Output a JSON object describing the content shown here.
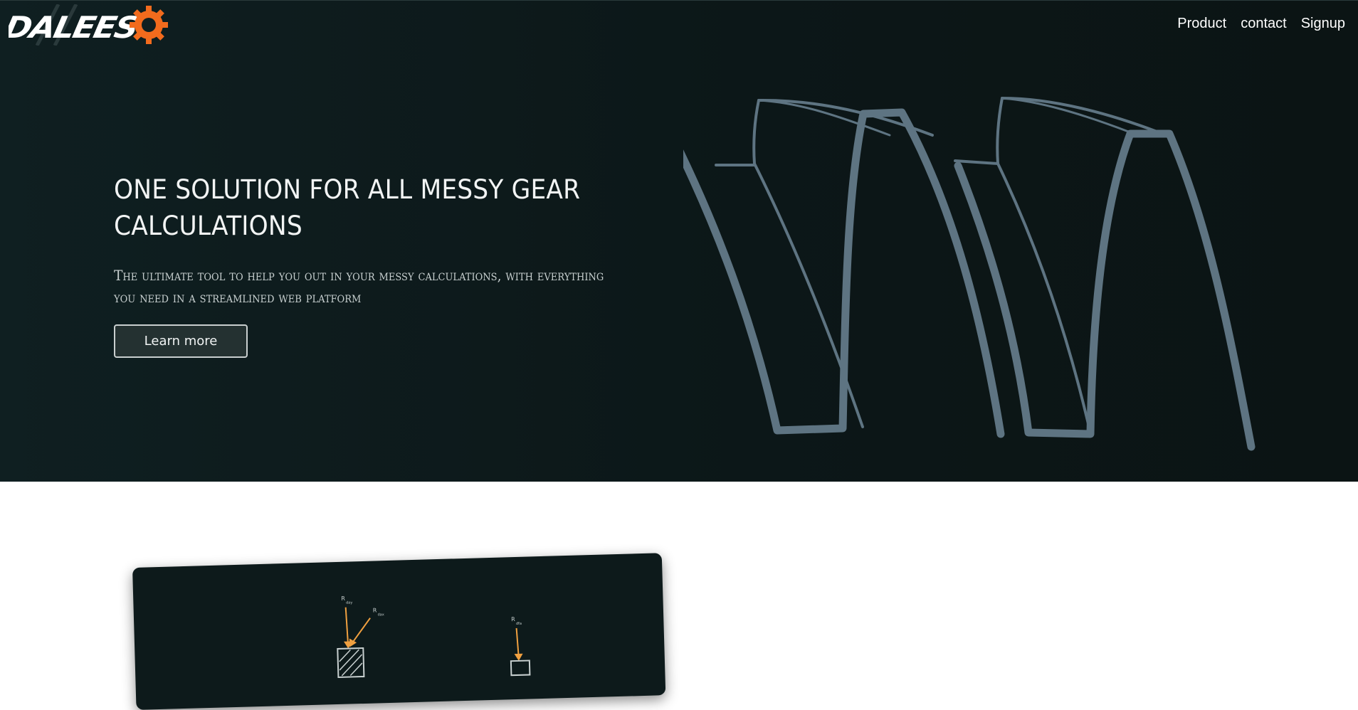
{
  "brand": {
    "logo_text": "DALEES",
    "accent": "#f26b1d",
    "logo_icon": "gear-icon"
  },
  "nav": {
    "items": [
      {
        "label": "Product"
      },
      {
        "label": "contact"
      },
      {
        "label": "Signup"
      }
    ]
  },
  "hero": {
    "headline": "ONE SOLUTION FOR ALL MESSY GEAR CALCULATIONS",
    "subhead": "The ultimate tool to help you out in your messy calculations, with everything you need in a streamlined web platform",
    "cta_label": "Learn more",
    "background": "#0c1718",
    "art_color": "#5e7482",
    "art_icon": "gear-teeth-illustration"
  },
  "preview": {
    "background": "#0d1a1b",
    "arrow_color": "#f0a040",
    "labels": [
      "R",
      "day",
      "R",
      "dax",
      "R",
      "dfa"
    ]
  }
}
